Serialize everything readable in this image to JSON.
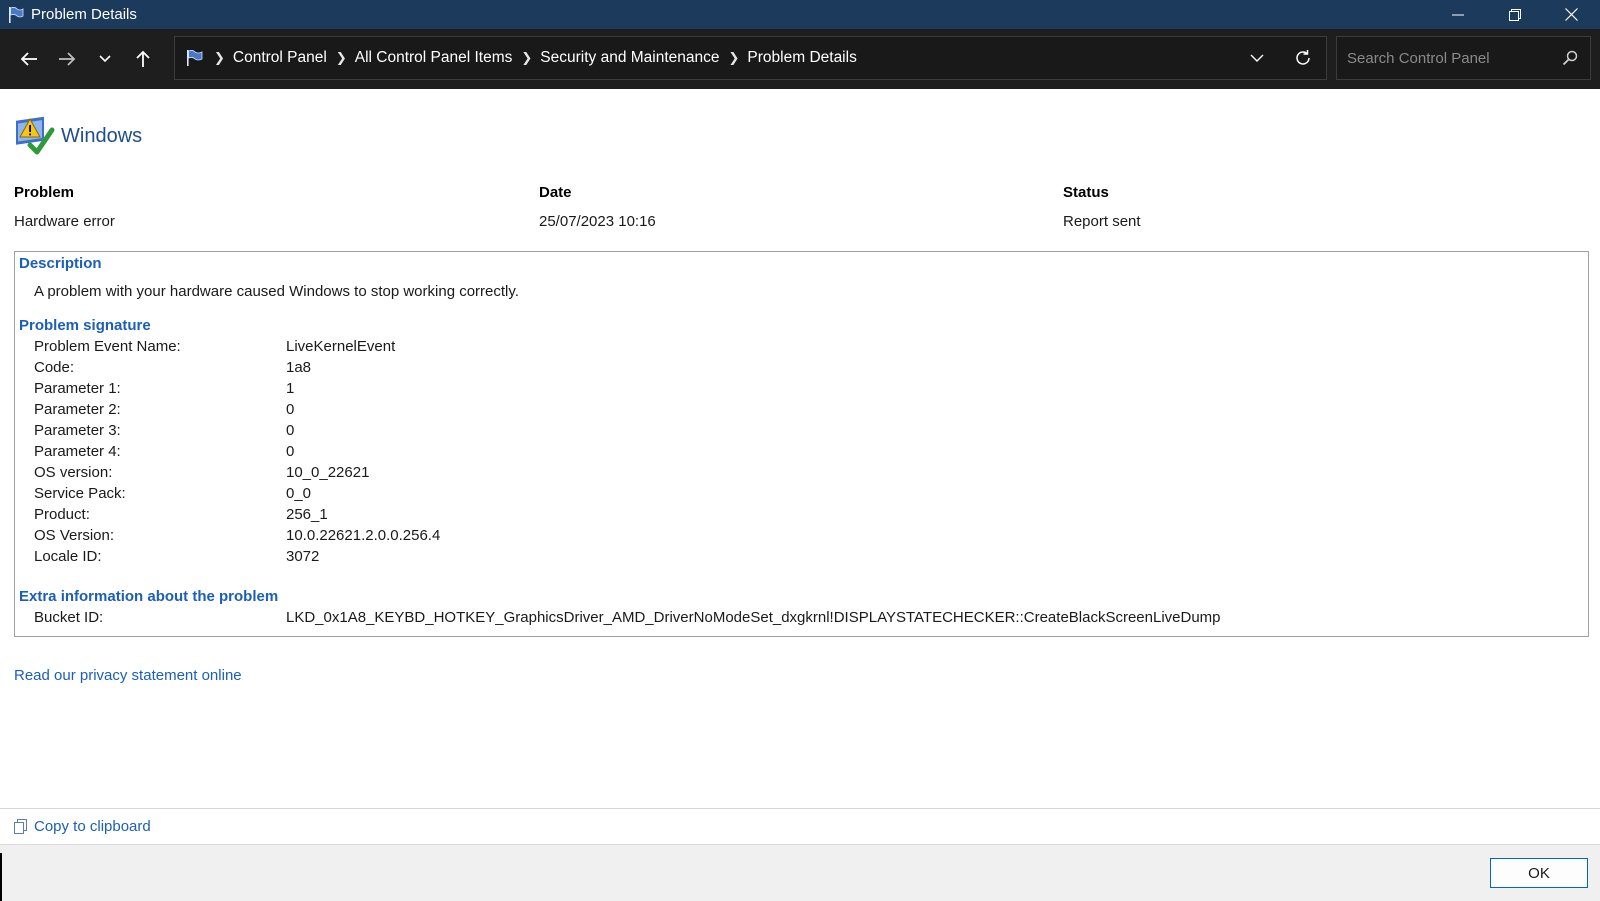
{
  "window": {
    "title": "Problem Details",
    "controls": {
      "minimize": "minimize-icon",
      "restore": "restore-icon",
      "close": "close-icon"
    }
  },
  "navigation": {
    "back_icon": "back-arrow-icon",
    "forward_icon": "forward-arrow-icon",
    "recent_icon": "chevron-down-icon",
    "up_icon": "up-arrow-icon",
    "breadcrumb": [
      "Control Panel",
      "All Control Panel Items",
      "Security and Maintenance",
      "Problem Details"
    ],
    "search_placeholder": "Search Control Panel"
  },
  "app": {
    "name": "Windows"
  },
  "summary": {
    "headers": {
      "problem": "Problem",
      "date": "Date",
      "status": "Status"
    },
    "values": {
      "problem": "Hardware error",
      "date": "25/07/2023 10:16",
      "status": "Report sent"
    }
  },
  "details": {
    "description_title": "Description",
    "description_text": "A problem with your hardware caused Windows to stop working correctly.",
    "signature_title": "Problem signature",
    "signature": [
      {
        "key": "Problem Event Name:",
        "value": "LiveKernelEvent"
      },
      {
        "key": "Code:",
        "value": "1a8"
      },
      {
        "key": "Parameter 1:",
        "value": "1"
      },
      {
        "key": "Parameter 2:",
        "value": "0"
      },
      {
        "key": "Parameter 3:",
        "value": "0"
      },
      {
        "key": "Parameter 4:",
        "value": "0"
      },
      {
        "key": "OS version:",
        "value": "10_0_22621"
      },
      {
        "key": "Service Pack:",
        "value": "0_0"
      },
      {
        "key": "Product:",
        "value": "256_1"
      },
      {
        "key": "OS Version:",
        "value": "10.0.22621.2.0.0.256.4"
      },
      {
        "key": "Locale ID:",
        "value": "3072"
      }
    ],
    "extra_title": "Extra information about the problem",
    "extra": [
      {
        "key": "Bucket ID:",
        "value": "LKD_0x1A8_KEYBD_HOTKEY_GraphicsDriver_AMD_DriverNoModeSet_dxgkrnl!DISPLAYSTATECHECKER::CreateBlackScreenLiveDump"
      }
    ]
  },
  "links": {
    "privacy": "Read our privacy statement online",
    "copy": "Copy to clipboard"
  },
  "buttons": {
    "ok": "OK"
  },
  "colors": {
    "titlebar": "#1b3a5c",
    "navbar": "#1e1e1e",
    "link": "#1b5fb8",
    "button_border": "#0067c0"
  }
}
